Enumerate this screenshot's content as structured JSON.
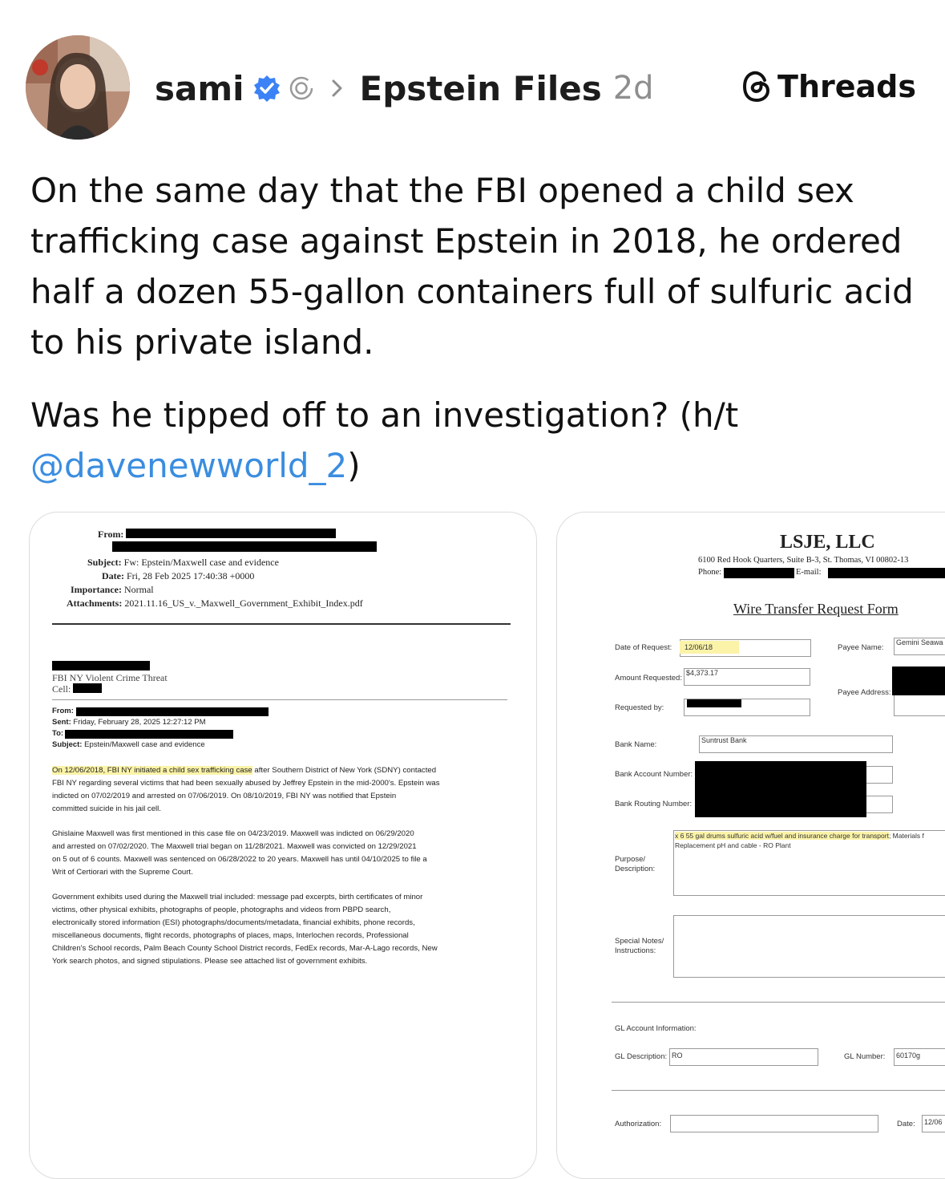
{
  "header": {
    "username": "sami",
    "topic": "Epstein Files",
    "time": "2d",
    "brand": "Threads"
  },
  "post": {
    "paragraph1": "On the same day that the FBI opened a child sex trafficking case against Epstein in 2018, he ordered half a dozen 55-gallon containers full of sulfuric acid to his private island.",
    "paragraph2": "Was he tipped off to an investigation? (h/t",
    "mention": "@davenewworld_2",
    "closing": ")"
  },
  "email_doc": {
    "from_label": "From:",
    "subject_label": "Subject:",
    "subject": "Fw: Epstein/Maxwell case and evidence",
    "date_label": "Date:",
    "date": "Fri, 28 Feb 2025 17:40:38 +0000",
    "importance_label": "Importance:",
    "importance": "Normal",
    "attachments_label": "Attachments:",
    "attachments": "2021.11.16_US_v._Maxwell_Government_Exhibit_Index.pdf",
    "sig_line1": "FBI NY Violent Crime Threat",
    "sig_line2": "Cell:",
    "inner_from_label": "From:",
    "inner_sent_label": "Sent:",
    "inner_sent": "Friday, February 28, 2025 12:27:12 PM",
    "inner_to_label": "To:",
    "inner_subject_label": "Subject:",
    "inner_subject": "Epstein/Maxwell case and evidence",
    "body1_highlight": "On 12/06/2018, FBI NY initiated a child sex trafficking case",
    "body1_rest": " after Southern District of New York (SDNY) contacted",
    "body1_lines": [
      "FBI NY regarding several victims that had been sexually abused by Jeffrey Epstein in the mid-2000's. Epstein was",
      "indicted on 07/02/2019 and arrested on 07/06/2019. On 08/10/2019, FBI NY was notified that Epstein",
      "committed suicide in his jail cell."
    ],
    "body2_lines": [
      "Ghislaine Maxwell was first mentioned in this case file on 04/23/2019. Maxwell was indicted on 06/29/2020",
      "and arrested on 07/02/2020. The Maxwell trial began on 11/28/2021.  Maxwell was convicted on 12/29/2021",
      "on 5 out of 6 counts. Maxwell was sentenced on 06/28/2022 to 20 years. Maxwell has until 04/10/2025 to file a",
      "Writ of Certiorari with the Supreme Court."
    ],
    "body3_lines": [
      "Government exhibits used during the Maxwell trial included: message pad excerpts, birth certificates of minor",
      "victims, other physical exhibits, photographs of people, photographs and videos from PBPD search,",
      "electronically stored information (ESI) photographs/documents/metadata, financial exhibits, phone records,",
      "miscellaneous documents, flight records, photographs of places, maps, Interlochen records, Professional",
      "Children's School records, Palm Beach County School District records, FedEx records, Mar-A-Lago records, New",
      "York search photos, and signed stipulations.  Please see attached list of government exhibits."
    ]
  },
  "wire_doc": {
    "company": "LSJE, LLC",
    "address": "6100 Red Hook Quarters, Suite B-3, St. Thomas, VI 00802-13",
    "phone_label": "Phone:",
    "email_label": "E-mail:",
    "form_title": "Wire Transfer Request Form",
    "date_req_label": "Date of Request:",
    "date_req": "12/06/18",
    "amount_label": "Amount Requested:",
    "amount": "$4,373.17",
    "requested_by_label": "Requested by:",
    "payee_name_label": "Payee Name:",
    "payee_name": "Gemini Seawa",
    "payee_address_label": "Payee Address:",
    "bank_name_label": "Bank Name:",
    "bank_name": "Suntrust Bank",
    "bank_account_label": "Bank Account Number:",
    "bank_routing_label": "Bank Routing Number:",
    "purpose_label_1": "Purpose/",
    "purpose_label_2": "Description:",
    "purpose_highlight": "x 6 55 gal drums sulfuric acid w/fuel and insurance charge for transport",
    "purpose_rest": "; Materials f",
    "purpose_line2": "Replacement pH and cable - RO Plant",
    "notes_label_1": "Special Notes/",
    "notes_label_2": "Instructions:",
    "gl_info_label": "GL Account Information:",
    "gl_desc_label": "GL Description:",
    "gl_desc": "RO",
    "gl_number_label": "GL Number:",
    "gl_number": "60170g",
    "auth_label": "Authorization:",
    "date_label": "Date:",
    "date_value": "12/06"
  },
  "colors": {
    "mention": "#3a8de0",
    "verified": "#3b82f6",
    "highlight": "#fbf3a8"
  }
}
